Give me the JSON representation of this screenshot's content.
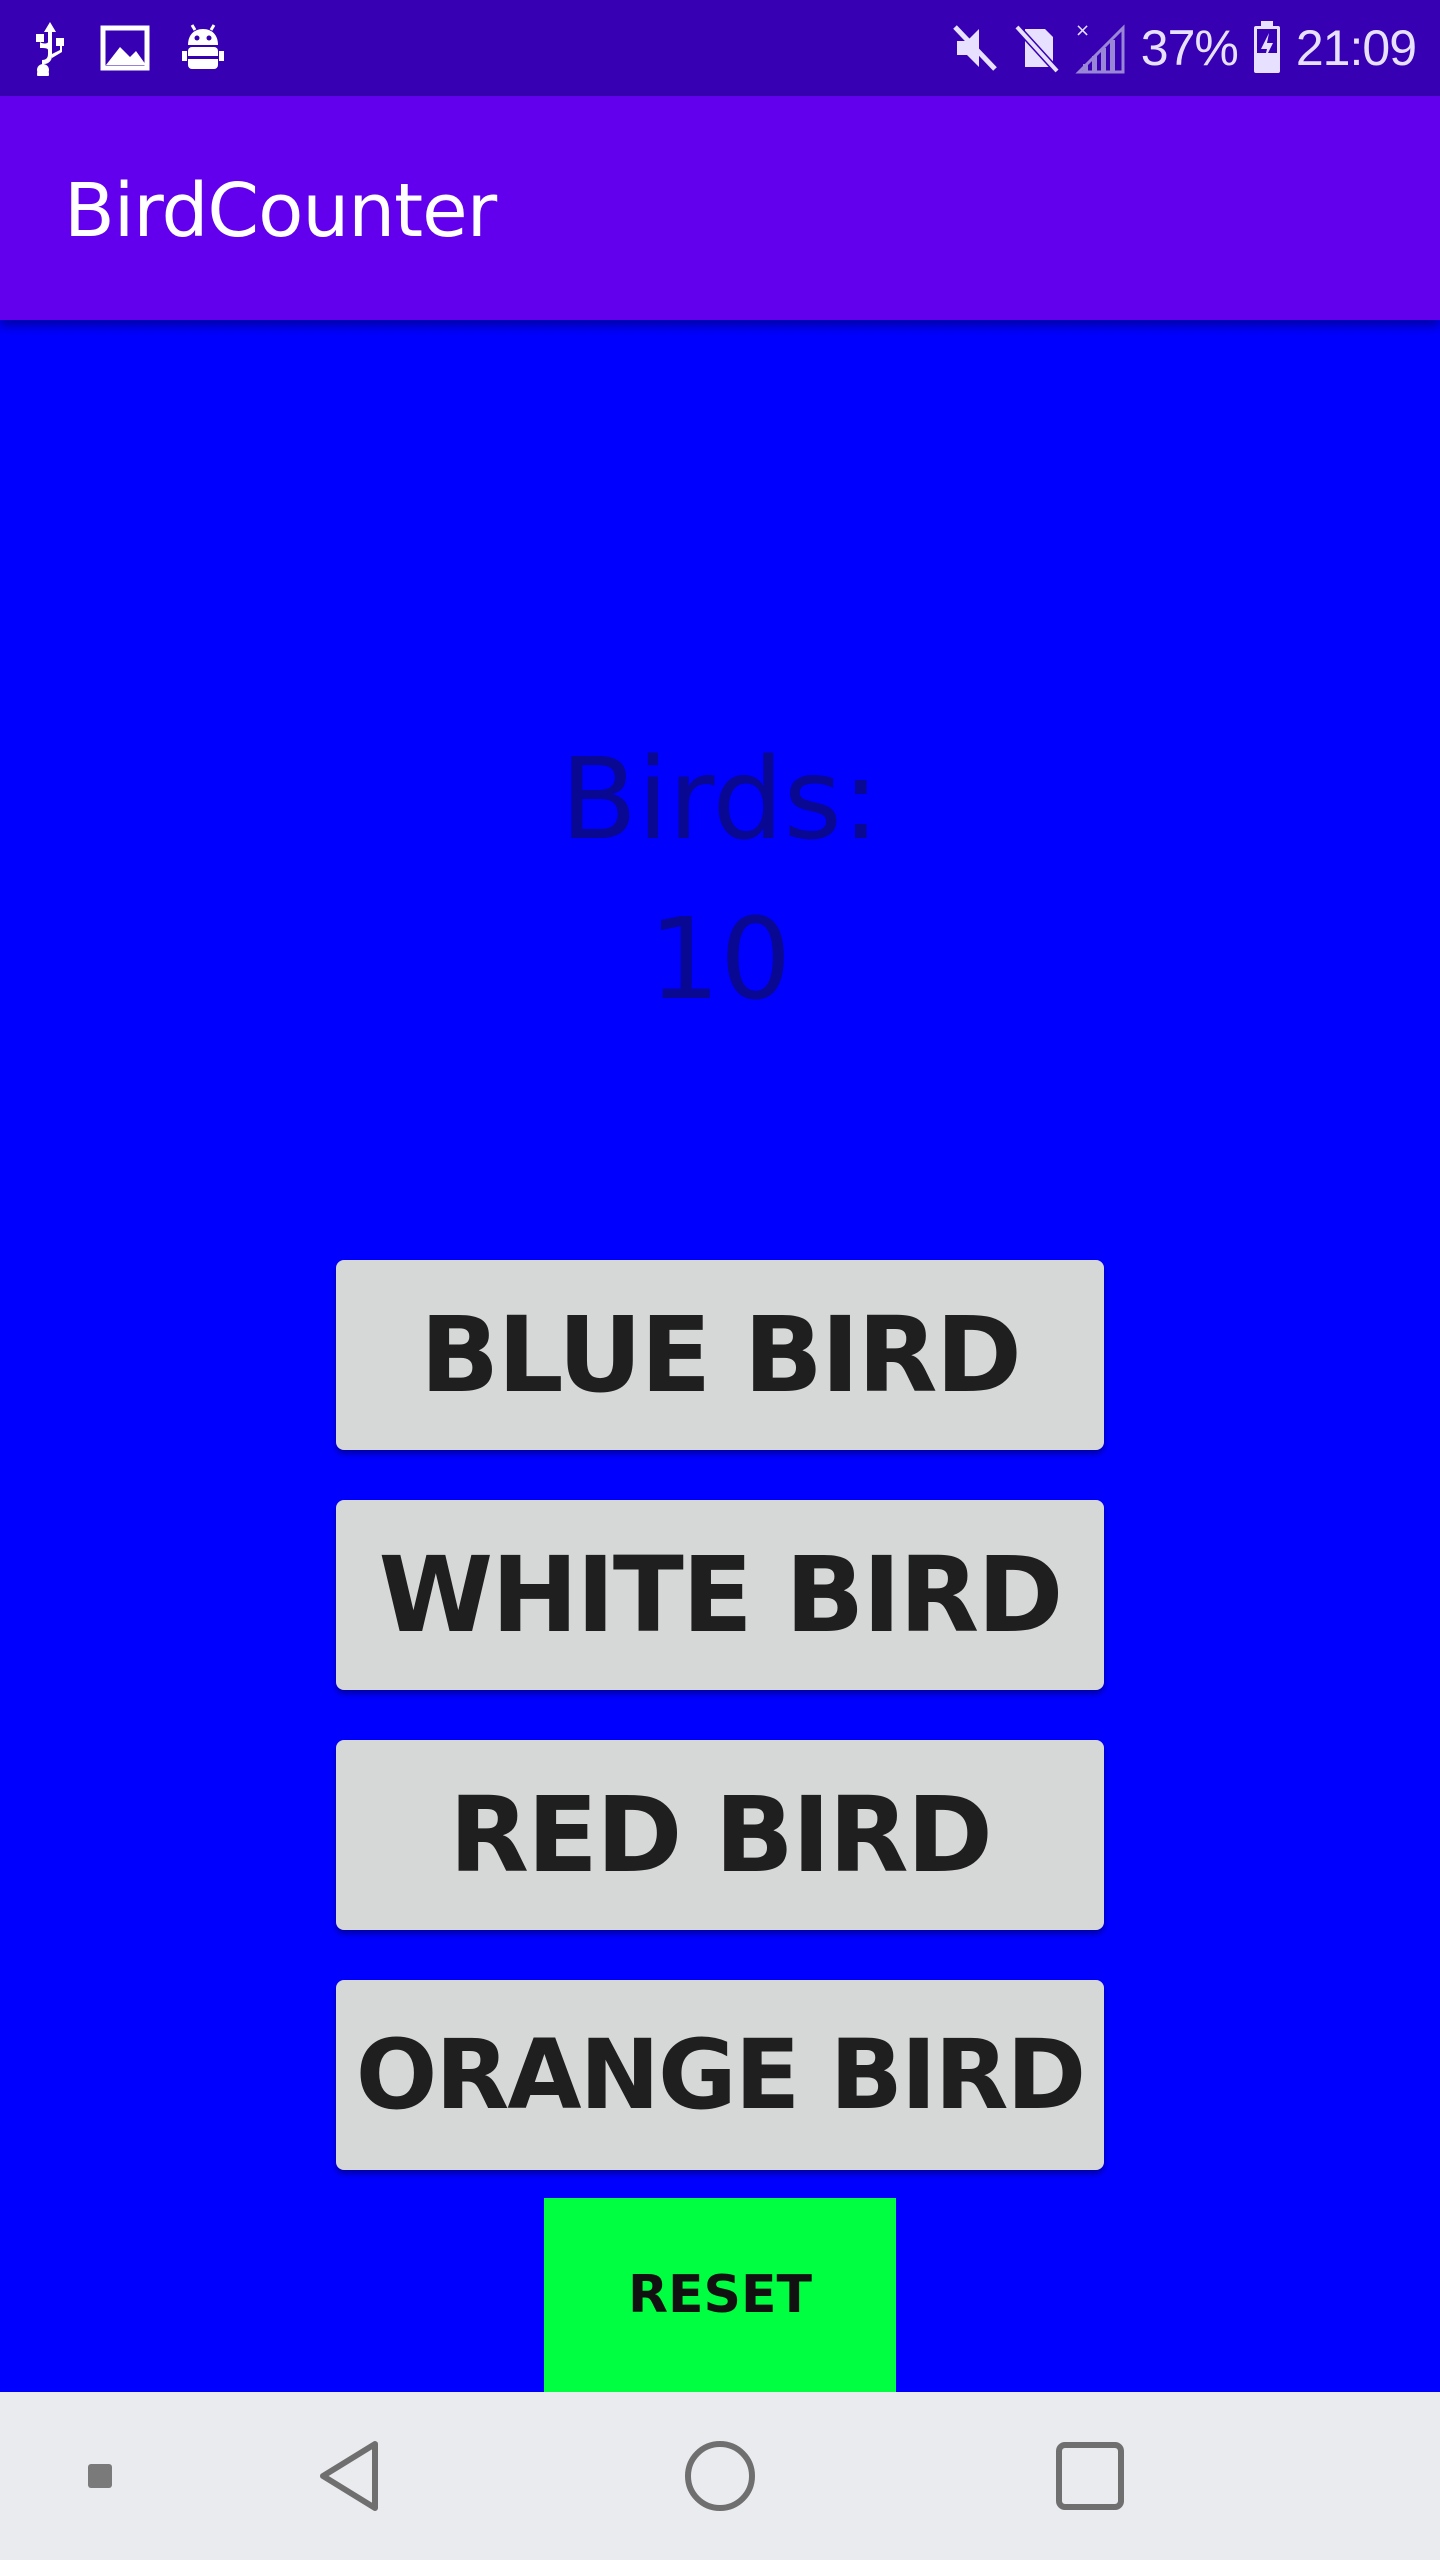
{
  "status_bar": {
    "left_icons": [
      "usb-icon",
      "image-icon",
      "android-debug-icon"
    ],
    "right_icons": [
      "vibrate-off-icon",
      "no-sim-icon",
      "signal-icon",
      "battery-charging-icon"
    ],
    "battery": "37%",
    "time": "21:09"
  },
  "app_bar": {
    "title": "BirdCounter"
  },
  "counter": {
    "label": "Birds:",
    "value": "10"
  },
  "buttons": {
    "blue": "BLUE BIRD",
    "white": "WHITE BIRD",
    "red": "RED BIRD",
    "orange": "ORANGE BIRD",
    "reset": "RESET"
  },
  "colors": {
    "status_bar": "#3700b3",
    "app_bar": "#6200ee",
    "background": "#0000ff",
    "bird_button": "#d6d7d7",
    "reset_button": "#00ff40",
    "nav_bar": "#eaebef"
  },
  "nav_bar": {
    "icons": [
      "square-dot-icon",
      "back-icon",
      "home-icon",
      "recents-icon"
    ]
  }
}
